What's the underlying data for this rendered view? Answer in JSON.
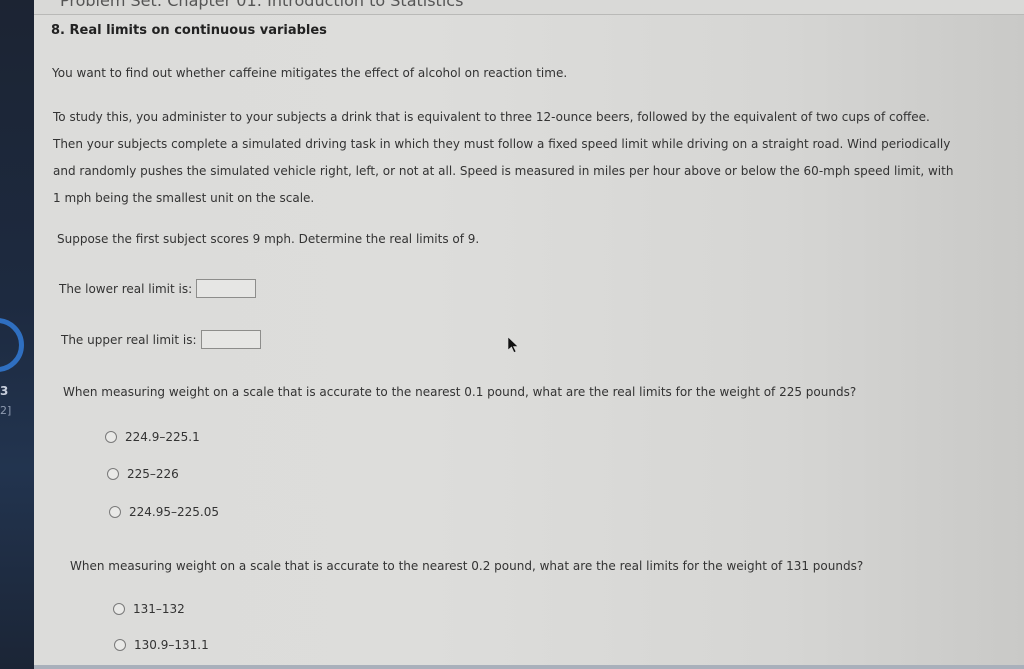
{
  "header": {
    "title": "Problem Set: Chapter 01: Introduction to Statistics"
  },
  "sidebar": {
    "badge_text": "3",
    "badge_subtext": "2]"
  },
  "section": {
    "title": "8. Real limits on continuous variables"
  },
  "intro": "You want to find out whether caffeine mitigates the effect of alcohol on reaction time.",
  "paragraph": {
    "lines": [
      "To study this, you administer to your subjects a drink that is equivalent to three 12-ounce beers, followed by the equivalent of two cups of coffee.",
      "Then your subjects complete a simulated driving task in which they must follow a fixed speed limit while driving on a straight road. Wind periodically",
      "and randomly pushes the simulated vehicle right, left, or not at all. Speed is measured in miles per hour above or below the 60-mph speed limit, with",
      "1 mph being the smallest unit on the scale."
    ]
  },
  "suppose": "Suppose the first subject scores 9 mph. Determine the real limits of 9.",
  "limits": {
    "lower": {
      "label": "The lower real limit is:",
      "value": ""
    },
    "upper": {
      "label": "The upper real limit is:",
      "value": ""
    }
  },
  "question1": {
    "text": "When measuring weight on a scale that is accurate to the nearest 0.1 pound, what are the real limits for the weight of 225 pounds?",
    "options": [
      "224.9–225.1",
      "225–226",
      "224.95–225.05"
    ],
    "selected": null
  },
  "question2": {
    "text": "When measuring weight on a scale that is accurate to the nearest 0.2 pound, what are the real limits for the weight of 131 pounds?",
    "options": [
      "131–132",
      "130.9–131.1"
    ],
    "selected": null
  },
  "icons": {
    "cursor": "arrow-cursor-icon",
    "radio": "radio-unchecked-icon"
  }
}
